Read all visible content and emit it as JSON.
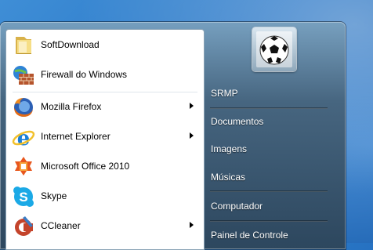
{
  "start_menu": {
    "pinned_items": [
      {
        "label": "SoftDownload",
        "icon": "folder-icon"
      },
      {
        "label": "Firewall do Windows",
        "icon": "firewall-icon"
      }
    ],
    "recent_items": [
      {
        "label": "Mozilla Firefox",
        "icon": "firefox-icon",
        "has_submenu": true
      },
      {
        "label": "Internet Explorer",
        "icon": "internet-explorer-icon",
        "has_submenu": true
      },
      {
        "label": "Microsoft Office 2010",
        "icon": "office-icon",
        "has_submenu": false
      },
      {
        "label": "Skype",
        "icon": "skype-icon",
        "has_submenu": false
      },
      {
        "label": "CCleaner",
        "icon": "ccleaner-icon",
        "has_submenu": true
      }
    ],
    "user_picture_icon": "soccer-ball-icon",
    "right_items": [
      {
        "label": "SRMP"
      },
      {
        "label": "Documentos"
      },
      {
        "label": "Imagens"
      },
      {
        "label": "Músicas"
      },
      {
        "label": "Computador"
      },
      {
        "label": "Painel de Controle"
      }
    ]
  },
  "colors": {
    "desktop": "#2a78c8",
    "menu_frame": "#46647d",
    "left_pane": "#ffffff"
  }
}
